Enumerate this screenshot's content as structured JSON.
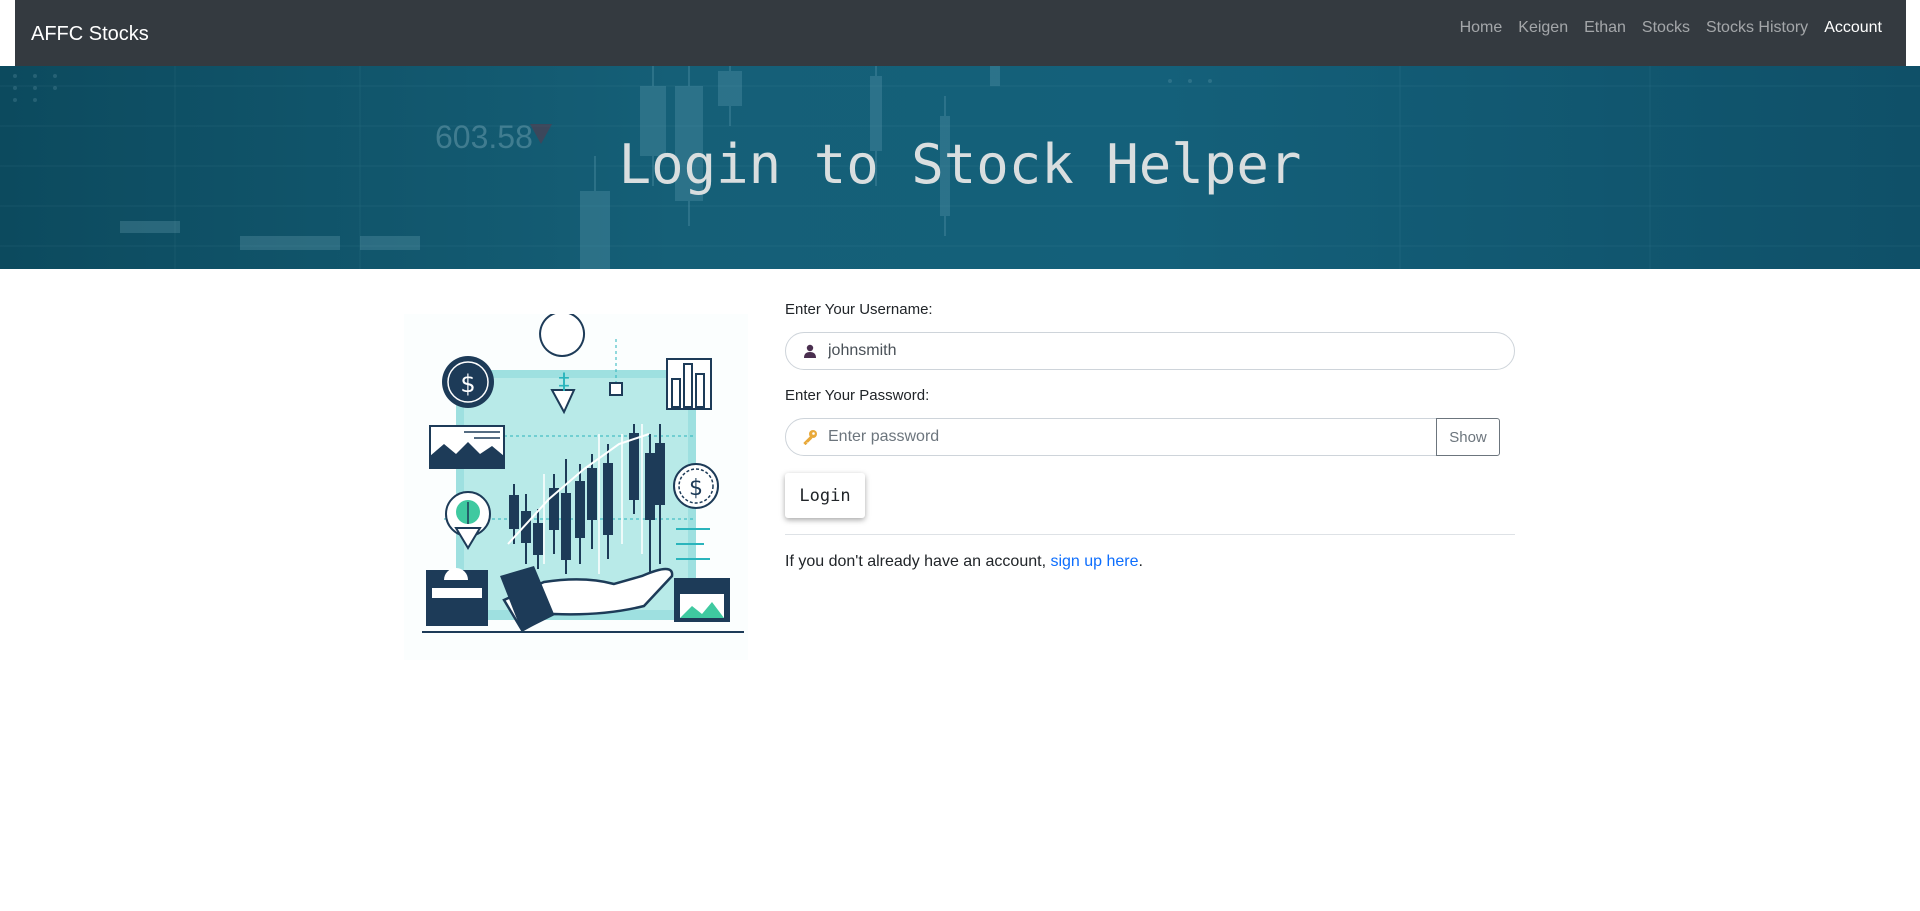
{
  "nav": {
    "brand": "AFFC Stocks",
    "links": [
      {
        "label": "Home",
        "active": false
      },
      {
        "label": "Keigen",
        "active": false
      },
      {
        "label": "Ethan",
        "active": false
      },
      {
        "label": "Stocks",
        "active": false
      },
      {
        "label": "Stocks History",
        "active": false
      },
      {
        "label": "Account",
        "active": true
      }
    ]
  },
  "hero": {
    "title": "Login to Stock Helper",
    "background_figure": "603.58"
  },
  "form": {
    "username_label": "Enter Your Username:",
    "username_value": "johnsmith",
    "username_icon": "user-icon",
    "password_label": "Enter Your Password:",
    "password_placeholder": "Enter password",
    "password_icon": "key-icon",
    "show_label": "Show",
    "login_label": "Login",
    "signup_prefix": "If you don't already have an account, ",
    "signup_link": "sign up here",
    "signup_suffix": "."
  },
  "colors": {
    "navbar": "#343a40",
    "hero": "#155f77",
    "link": "#0d6efd",
    "illustration_accent": "#5cc8cc",
    "illustration_dark": "#163a55"
  }
}
